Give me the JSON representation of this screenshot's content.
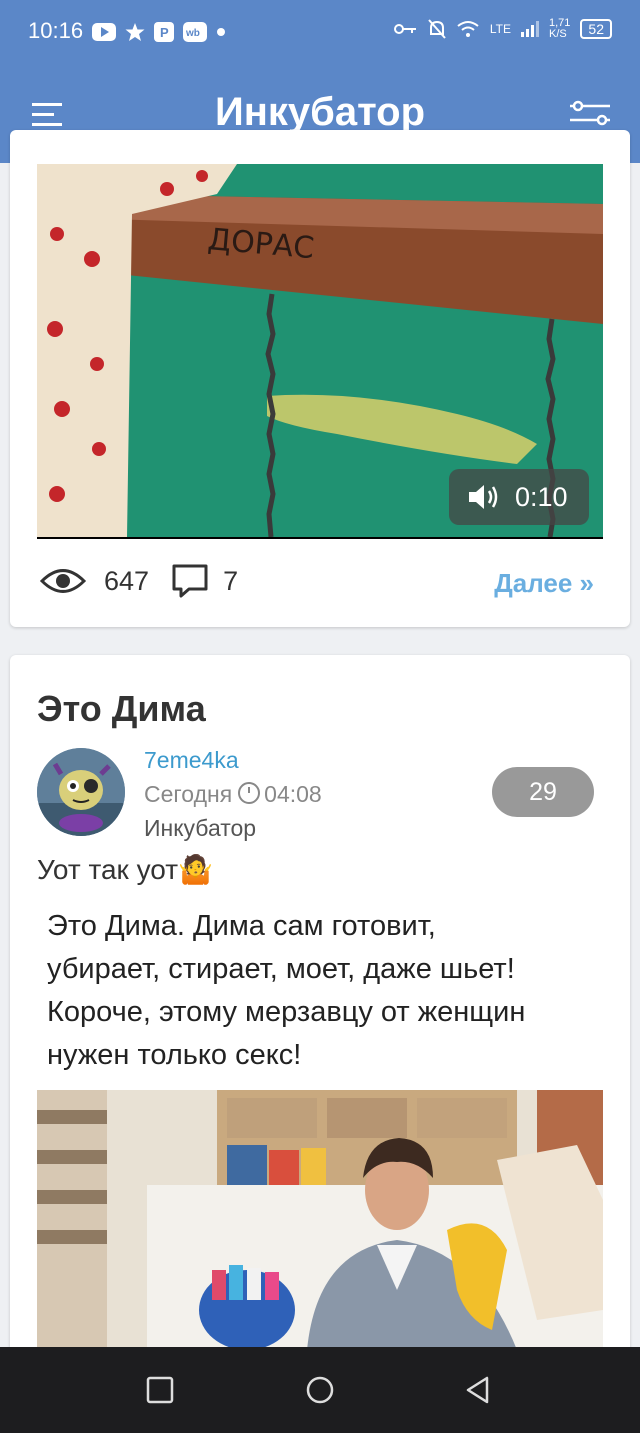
{
  "status_bar": {
    "time": "10:16",
    "network_speed": "1,71",
    "network_unit": "K/S",
    "network_type": "LTE",
    "battery": "52"
  },
  "app_bar": {
    "title": "Инкубатор"
  },
  "post_1": {
    "video_duration": "0:10",
    "views": "647",
    "comments": "7",
    "more_link": "Далее »"
  },
  "post_2": {
    "title": "Это Дима",
    "author": "7eme4ka",
    "date_label": "Сегодня",
    "time": "04:08",
    "category": "Инкубатор",
    "rating": "29",
    "intro": "Уот так уот🤷",
    "quote_lines": [
      "Это Дима. Дима сам готовит,",
      "убирает, стирает, моет, даже шьет!",
      "Короче, этому мерзавцу от женщин",
      "нужен только секс!"
    ]
  },
  "colors": {
    "header_blue": "#5b87c8",
    "link_blue": "#3c9acd",
    "more_link": "#6aaee0",
    "rating_bg": "#999999"
  }
}
